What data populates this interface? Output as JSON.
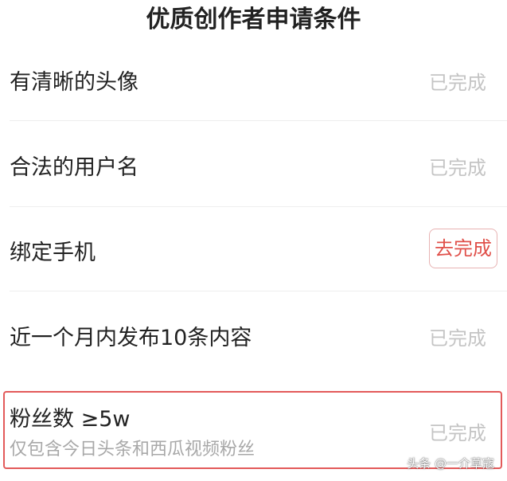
{
  "header": {
    "title": "优质创作者申请条件"
  },
  "conditions": [
    {
      "label": "有清晰的头像",
      "status": "已完成"
    },
    {
      "label": "合法的用户名",
      "status": "已完成"
    },
    {
      "label": "绑定手机",
      "action": "去完成"
    },
    {
      "label": "近一个月内发布10条内容",
      "status": "已完成"
    },
    {
      "label": "粉丝数 ≥5w",
      "sublabel": "仅包含今日头条和西瓜视频粉丝",
      "status": "已完成"
    }
  ],
  "watermark": "头条 @一介草寇",
  "colors": {
    "accent_red": "#e0504a",
    "highlight_border": "#e35a5a",
    "completed_gray": "#c4c4c4"
  }
}
